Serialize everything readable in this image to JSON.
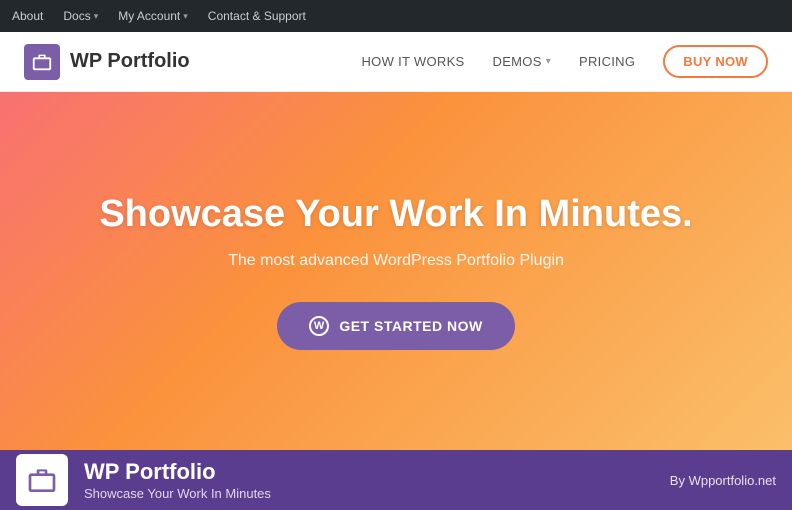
{
  "adminBar": {
    "items": [
      {
        "label": "About",
        "hasDropdown": false
      },
      {
        "label": "Docs",
        "hasDropdown": true
      },
      {
        "label": "My Account",
        "hasDropdown": true
      },
      {
        "label": "Contact & Support",
        "hasDropdown": false
      }
    ]
  },
  "mainNav": {
    "logoText": "WP Portfolio",
    "links": [
      {
        "label": "HOW IT WORKS",
        "hasDropdown": false
      },
      {
        "label": "DEMOS",
        "hasDropdown": true
      },
      {
        "label": "PRICING",
        "hasDropdown": false
      }
    ],
    "buyNowLabel": "BUY NOW"
  },
  "hero": {
    "headline": "Showcase Your Work In Minutes.",
    "subheadline": "The most advanced WordPress Portfolio Plugin",
    "ctaLabel": "GET STARTED NOW"
  },
  "infoBar": {
    "pluginName": "WP Portfolio",
    "pluginTagline": "Showcase Your Work In Minutes",
    "author": "By Wpportfolio.net"
  }
}
